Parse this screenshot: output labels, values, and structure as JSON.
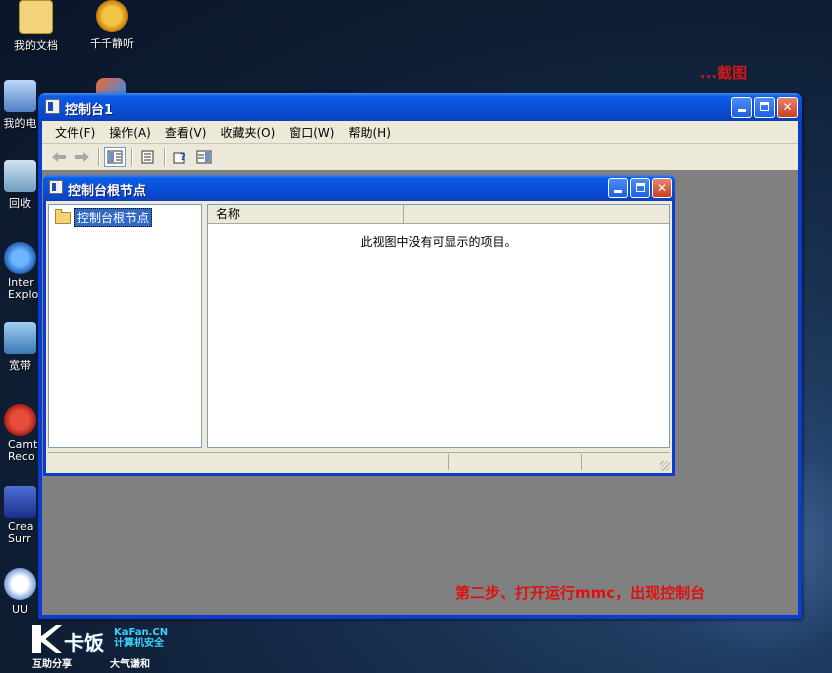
{
  "desktop": {
    "icons": [
      {
        "label": "我的文档"
      },
      {
        "label": "千千静听"
      },
      {
        "label": "我的电"
      },
      {
        "label": "回收"
      },
      {
        "label": "Inter Explo"
      },
      {
        "label": "宽带"
      },
      {
        "label": "Camt Reco"
      },
      {
        "label": "Crea Surr"
      },
      {
        "label": "UU"
      }
    ],
    "top_caption": "...截图",
    "step_caption": "第二步、打开运行mmc，出现控制台",
    "watermark": {
      "name": "卡饭",
      "site_line1": "KaFan.CN",
      "site_line2": "计算机安全",
      "sub1": "互助分享",
      "sub2": "大气谦和"
    }
  },
  "mmc": {
    "title": "控制台1",
    "menu": [
      "文件(F)",
      "操作(A)",
      "查看(V)",
      "收藏夹(O)",
      "窗口(W)",
      "帮助(H)"
    ],
    "toolbar_icons": [
      "back-arrow-icon",
      "forward-arrow-icon",
      "show-hide-tree-icon",
      "export-list-icon",
      "help-icon",
      "show-hide-action-pane-icon"
    ]
  },
  "child": {
    "title": "控制台根节点",
    "tree_root": "控制台根节点",
    "column_header": "名称",
    "empty_message": "此视图中没有可显示的项目。"
  },
  "colors": {
    "xp_blue": "#0a50d8",
    "dialog_face": "#ece9d8",
    "mdi_background": "#808080",
    "caption_red": "#e01010"
  }
}
